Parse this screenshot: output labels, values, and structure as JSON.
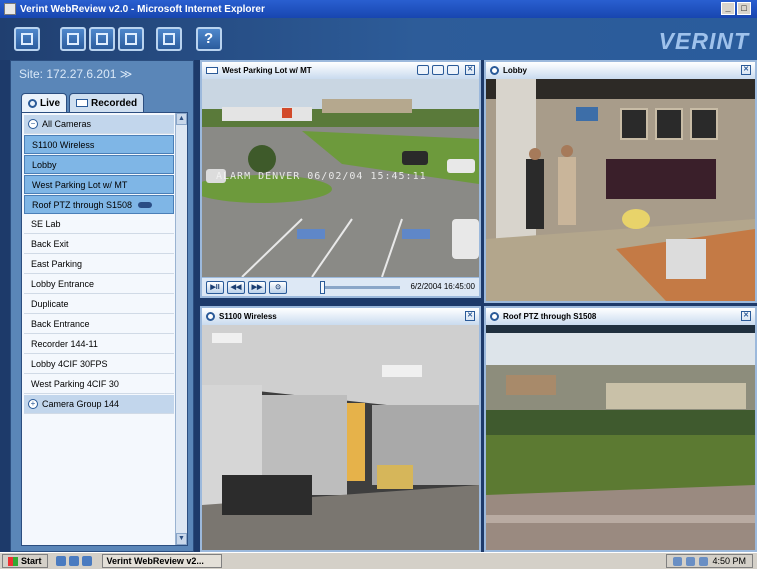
{
  "window": {
    "title": "Verint WebReview v2.0 - Microsoft Internet Explorer",
    "controls": [
      "_",
      "□"
    ]
  },
  "toolbar": {
    "buttons": [
      "single-view-icon",
      "quad-view-icon",
      "grid-view-icon",
      "multi-view-icon",
      "export-icon",
      "help-icon"
    ],
    "help_label": "?",
    "brand": "VERINT"
  },
  "sidebar": {
    "site_label": "Site: 172.27.6.201 ≫",
    "tabs": [
      {
        "label": "Live",
        "active": true
      },
      {
        "label": "Recorded",
        "active": false
      }
    ],
    "items": [
      {
        "label": "All Cameras",
        "kind": "group",
        "icon": "collapse-icon",
        "symbol": "−"
      },
      {
        "label": "S1100 Wireless",
        "kind": "selected"
      },
      {
        "label": "Lobby",
        "kind": "selected"
      },
      {
        "label": "West Parking Lot w/ MT",
        "kind": "selected"
      },
      {
        "label": "Roof PTZ through S1508",
        "kind": "selected",
        "ptz": true
      },
      {
        "label": "SE Lab",
        "kind": "plain"
      },
      {
        "label": "Back Exit",
        "kind": "plain"
      },
      {
        "label": "East Parking",
        "kind": "plain"
      },
      {
        "label": "Lobby Entrance",
        "kind": "plain"
      },
      {
        "label": "Duplicate",
        "kind": "plain"
      },
      {
        "label": "Back Entrance",
        "kind": "plain"
      },
      {
        "label": "Recorder 144-11",
        "kind": "plain"
      },
      {
        "label": "Lobby 4CIF 30FPS",
        "kind": "plain"
      },
      {
        "label": "West Parking 4CIF 30",
        "kind": "plain"
      },
      {
        "label": "Camera Group 144",
        "kind": "group",
        "icon": "expand-icon",
        "symbol": "+"
      }
    ]
  },
  "tiles": {
    "top_left": {
      "title": "West Parking Lot w/ MT",
      "osd": "ALARM DENVER  06/02/04 15:45:11",
      "timestamp": "6/2/2004  16:45:00",
      "play_buttons": [
        "▶II",
        "◀◀",
        "▶▶",
        "⊙"
      ]
    },
    "top_right": {
      "title": "Lobby"
    },
    "bottom_left": {
      "title": "S1100 Wireless"
    },
    "bottom_right": {
      "title": "Roof PTZ through S1508"
    }
  },
  "taskbar": {
    "start_label": "Start",
    "task_label": "Verint WebReview v2...",
    "clock": "4:50 PM"
  },
  "colors": {
    "toolbar": "#2d5c99",
    "panel": "#5a86b8",
    "selected_row": "#7fb6e6",
    "tile_border": "#9cb9dc"
  }
}
